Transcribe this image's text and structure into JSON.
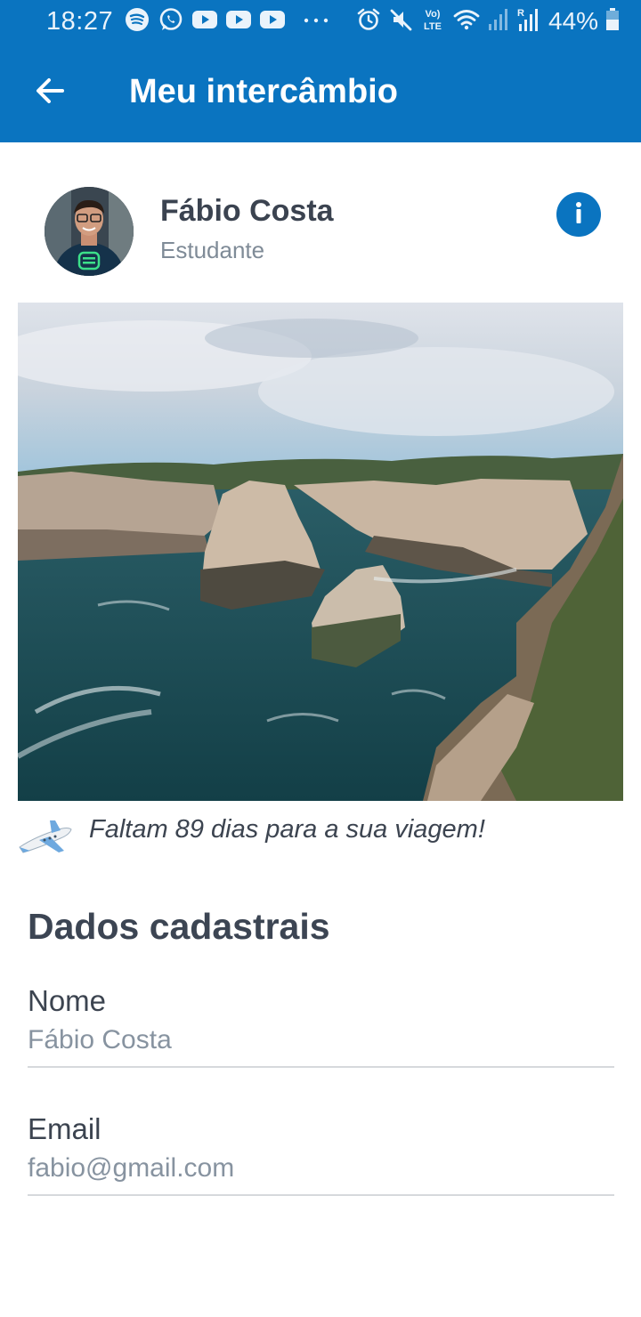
{
  "status_bar": {
    "time": "18:27",
    "battery": "44%",
    "icons": [
      "spotify-icon",
      "whatsapp-icon",
      "youtube-icon",
      "youtube-icon",
      "youtube-icon",
      "more-icon",
      "alarm-icon",
      "mute-icon",
      "volte-icon",
      "wifi-icon",
      "signal-icon",
      "signal-roaming-icon",
      "battery-icon"
    ]
  },
  "app_bar": {
    "title": "Meu intercâmbio",
    "back_icon": "arrow-back-icon",
    "background": "#0a74c0"
  },
  "profile": {
    "name": "Fábio Costa",
    "role": "Estudante",
    "info_icon": "info-icon"
  },
  "countdown": {
    "text": "Faltam 89 dias para a sua viagem!",
    "icon": "airplane-icon"
  },
  "form": {
    "section_title": "Dados cadastrais",
    "fields": [
      {
        "label": "Nome",
        "value": "Fábio Costa"
      },
      {
        "label": "Email",
        "value": "fabio@gmail.com"
      }
    ]
  }
}
